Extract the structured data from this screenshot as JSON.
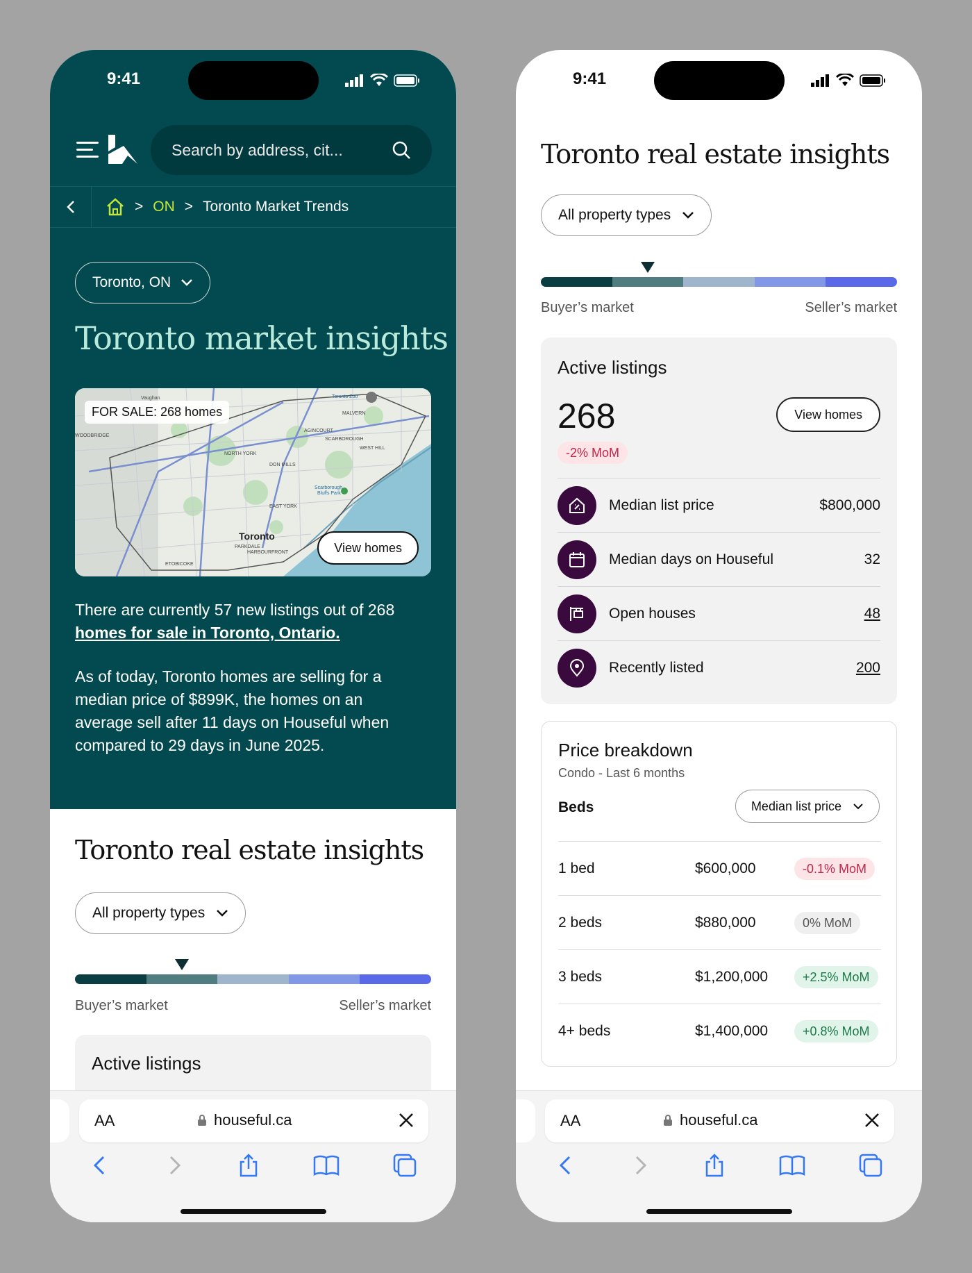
{
  "status": {
    "time": "9:41"
  },
  "nav": {
    "search_placeholder": "Search by address, cit..."
  },
  "breadcrumb": {
    "province": "ON",
    "current": "Toronto Market Trends"
  },
  "left": {
    "location_label": "Toronto, ON",
    "title": "Toronto market insights",
    "map": {
      "badge": "FOR SALE: 268 homes",
      "view_homes": "View homes",
      "labels": [
        "Vaughan",
        "Toronto Zoo",
        "MALVERN",
        "AGINCOURT",
        "SCARBOROUGH",
        "NORTH YORK",
        "DON MILLS",
        "EAST YORK",
        "Toronto",
        "ETOBICOKE",
        "WOODBRIDGE",
        "Scarborough Bluffs Park",
        "HARBOURFRONT",
        "PARKDALE",
        "WEST HILL"
      ]
    },
    "intro_text": "There are currently 57 new listings out of 268",
    "intro_link": "homes for sale in Toronto, Ontario.",
    "paragraph": "As of today, Toronto homes are selling for a median price of $899K, the homes on an average sell after 11 days on Houseful when compared to 29 days in June 2025.",
    "insights_title": "Toronto real estate insights",
    "property_type": "All property types",
    "buyers_market": "Buyer’s market",
    "sellers_market": "Seller’s market",
    "active_listings_title": "Active listings"
  },
  "right": {
    "insights_title": "Toronto real estate insights",
    "property_type": "All property types",
    "buyers_market": "Buyer’s market",
    "sellers_market": "Seller’s market",
    "active_listings": {
      "title": "Active listings",
      "count": "268",
      "mom": "-2% MoM",
      "view_homes": "View homes",
      "rows": [
        {
          "label": "Median list price",
          "value": "$800,000",
          "icon": "house-tag-icon"
        },
        {
          "label": "Median days on Houseful",
          "value": "32",
          "icon": "calendar-icon"
        },
        {
          "label": "Open houses",
          "value": "48",
          "icon": "open-house-sign-icon"
        },
        {
          "label": "Recently listed",
          "value": "200",
          "icon": "location-pin-icon"
        }
      ]
    },
    "price_breakdown": {
      "title": "Price breakdown",
      "subtitle": "Condo - Last 6 months",
      "beds_header": "Beds",
      "metric": "Median list price",
      "rows": [
        {
          "beds": "1 bed",
          "price": "$600,000",
          "mom": "-0.1% MoM",
          "trend": "neg"
        },
        {
          "beds": "2 beds",
          "price": "$880,000",
          "mom": "0% MoM",
          "trend": "zero"
        },
        {
          "beds": "3 beds",
          "price": "$1,200,000",
          "mom": "+2.5% MoM",
          "trend": "pos"
        },
        {
          "beds": "4+ beds",
          "price": "$1,400,000",
          "mom": "+0.8% MoM",
          "trend": "pos"
        }
      ]
    }
  },
  "market_meter": {
    "position": 0.3,
    "colors": [
      "#0b3e43",
      "#4f7d80",
      "#9fb5cc",
      "#8298e6",
      "#5969e8"
    ]
  },
  "safari": {
    "aa": "AA",
    "url": "houseful.ca"
  },
  "theme": {
    "dark_teal": "#024a4f",
    "accent_lime": "#c4e63a",
    "mint_title": "#b9eadc",
    "icon_purple": "#3a0a3e"
  }
}
